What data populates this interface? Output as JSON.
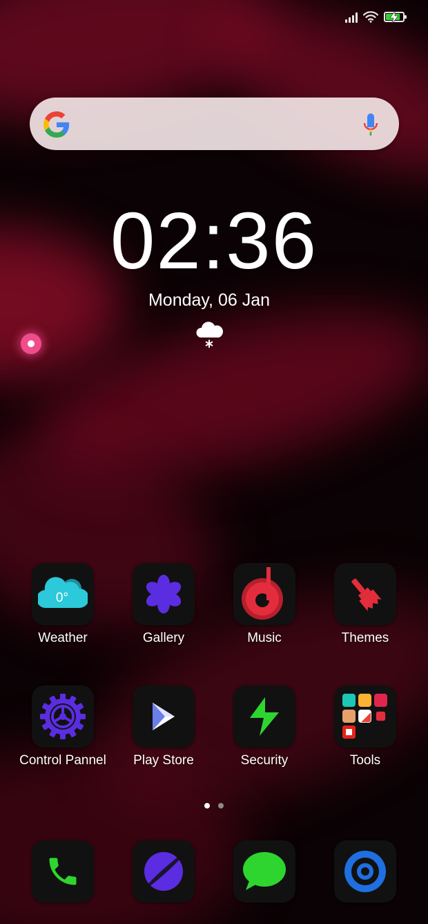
{
  "status_bar": {
    "signal_icon": "signal-icon",
    "wifi_icon": "wifi-icon",
    "battery_icon": "battery-charging-icon",
    "battery_level": 0.85
  },
  "search": {
    "logo_icon": "google-g-icon",
    "voice_icon": "mic-icon"
  },
  "clock": {
    "time": "02:36",
    "date": "Monday, 06 Jan",
    "weather_icon": "snow-cloud-icon"
  },
  "apps": [
    {
      "label": "Weather",
      "icon": "weather-icon",
      "temp": "0°"
    },
    {
      "label": "Gallery",
      "icon": "gallery-flower-icon"
    },
    {
      "label": "Music",
      "icon": "music-note-icon"
    },
    {
      "label": "Themes",
      "icon": "paintbrush-icon"
    },
    {
      "label": "Control Pannel",
      "icon": "settings-gear-icon"
    },
    {
      "label": "Play Store",
      "icon": "play-store-icon"
    },
    {
      "label": "Security",
      "icon": "lightning-icon"
    },
    {
      "label": "Tools",
      "icon": "tools-folder-icon"
    }
  ],
  "page_indicator": {
    "current": 1,
    "total": 2
  },
  "dock": [
    {
      "icon": "phone-icon"
    },
    {
      "icon": "browser-planet-icon"
    },
    {
      "icon": "messages-icon"
    },
    {
      "icon": "camera-icon"
    }
  ],
  "colors": {
    "accent_red": "#e32d3c",
    "purple": "#5b2de0",
    "green": "#2ed52e",
    "teal": "#2bc9d9",
    "blue": "#1f6fe0"
  }
}
